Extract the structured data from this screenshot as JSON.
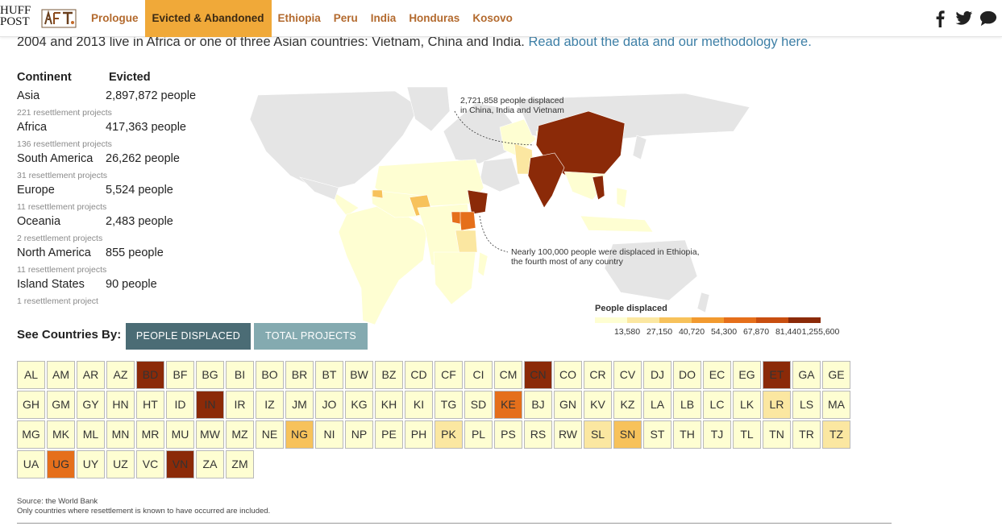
{
  "header": {
    "logo_line1": "HUFF",
    "logo_line2": "POST",
    "nav": [
      {
        "label": "Prologue",
        "active": false
      },
      {
        "label": "Evicted & Abandoned",
        "active": true
      },
      {
        "label": "Ethiopia",
        "active": false
      },
      {
        "label": "Peru",
        "active": false
      },
      {
        "label": "India",
        "active": false
      },
      {
        "label": "Honduras",
        "active": false
      },
      {
        "label": "Kosovo",
        "active": false
      }
    ],
    "social": [
      "facebook-icon",
      "twitter-icon",
      "comment-icon"
    ]
  },
  "intro": {
    "text": "2004 and 2013 live in Africa or one of three Asian countries: Vietnam, China and India. ",
    "link": "Read about the data and our methodology here."
  },
  "continents": {
    "col1": "Continent",
    "col2": "Evicted",
    "rows": [
      {
        "name": "Asia",
        "value": "2,897,872 people",
        "projects": "221 resettlement projects"
      },
      {
        "name": "Africa",
        "value": "417,363 people",
        "projects": "136 resettlement projects"
      },
      {
        "name": "South America",
        "value": "26,262 people",
        "projects": "31 resettlement projects"
      },
      {
        "name": "Europe",
        "value": "5,524 people",
        "projects": "11 resettlement projects"
      },
      {
        "name": "Oceania",
        "value": "2,483 people",
        "projects": "2 resettlement projects"
      },
      {
        "name": "North America",
        "value": "855 people",
        "projects": "11 resettlement projects"
      },
      {
        "name": "Island States",
        "value": "90 people",
        "projects": "1 resettlement project"
      }
    ]
  },
  "map": {
    "annotation_asia_line1": "2,721,858 people displaced",
    "annotation_asia_line2": "in China, India and Vietnam",
    "annotation_ethiopia_line1": "Nearly 100,000 people were displaced in Ethiopia,",
    "annotation_ethiopia_line2": "the fourth most of any country",
    "colors": {
      "none": "#e0e0e0",
      "c1": "#fefed2",
      "c2": "#fbe7a1",
      "c3": "#f7c25b",
      "c4": "#f29a2f",
      "c5": "#e56f1b",
      "c6": "#c84e10",
      "c7": "#8b2a08"
    }
  },
  "legend": {
    "title": "People displaced",
    "colors": [
      "#fefed2",
      "#fbe7a1",
      "#f7c25b",
      "#f29a2f",
      "#e56f1b",
      "#c84e10",
      "#8b2a08"
    ],
    "ticks": [
      "13,580",
      "27,150",
      "40,720",
      "54,300",
      "67,870",
      "81,440",
      "1,255,600"
    ]
  },
  "controls": {
    "see_label": "See Countries By:",
    "btn_people": "PEOPLE DISPLACED",
    "btn_projects": "TOTAL PROJECTS"
  },
  "countries": [
    {
      "code": "AL",
      "level": 1
    },
    {
      "code": "AM",
      "level": 1
    },
    {
      "code": "AR",
      "level": 1
    },
    {
      "code": "AZ",
      "level": 1
    },
    {
      "code": "BD",
      "level": 7
    },
    {
      "code": "BF",
      "level": 1
    },
    {
      "code": "BG",
      "level": 1
    },
    {
      "code": "BI",
      "level": 1
    },
    {
      "code": "BO",
      "level": 1
    },
    {
      "code": "BR",
      "level": 1
    },
    {
      "code": "BT",
      "level": 1
    },
    {
      "code": "BW",
      "level": 1
    },
    {
      "code": "BZ",
      "level": 1
    },
    {
      "code": "CD",
      "level": 1
    },
    {
      "code": "CF",
      "level": 1
    },
    {
      "code": "CI",
      "level": 1
    },
    {
      "code": "CM",
      "level": 1
    },
    {
      "code": "CN",
      "level": 7
    },
    {
      "code": "CO",
      "level": 1
    },
    {
      "code": "CR",
      "level": 1
    },
    {
      "code": "CV",
      "level": 1
    },
    {
      "code": "DJ",
      "level": 1
    },
    {
      "code": "DO",
      "level": 1
    },
    {
      "code": "EC",
      "level": 1
    },
    {
      "code": "EG",
      "level": 1
    },
    {
      "code": "ET",
      "level": 7
    },
    {
      "code": "GA",
      "level": 1
    },
    {
      "code": "GE",
      "level": 1
    },
    {
      "code": "GH",
      "level": 1
    },
    {
      "code": "GM",
      "level": 1
    },
    {
      "code": "GY",
      "level": 1
    },
    {
      "code": "HN",
      "level": 1
    },
    {
      "code": "HT",
      "level": 1
    },
    {
      "code": "ID",
      "level": 1
    },
    {
      "code": "IN",
      "level": 7
    },
    {
      "code": "IR",
      "level": 1
    },
    {
      "code": "IZ",
      "level": 1
    },
    {
      "code": "JM",
      "level": 1
    },
    {
      "code": "JO",
      "level": 1
    },
    {
      "code": "KG",
      "level": 1
    },
    {
      "code": "KH",
      "level": 1
    },
    {
      "code": "KI",
      "level": 1
    },
    {
      "code": "TG",
      "level": 1
    },
    {
      "code": "SD",
      "level": 1
    },
    {
      "code": "KE",
      "level": 5
    },
    {
      "code": "BJ",
      "level": 1
    },
    {
      "code": "GN",
      "level": 1
    },
    {
      "code": "KV",
      "level": 1
    },
    {
      "code": "KZ",
      "level": 1
    },
    {
      "code": "LA",
      "level": 1
    },
    {
      "code": "LB",
      "level": 1
    },
    {
      "code": "LC",
      "level": 1
    },
    {
      "code": "LK",
      "level": 1
    },
    {
      "code": "LR",
      "level": 2
    },
    {
      "code": "LS",
      "level": 1
    },
    {
      "code": "MA",
      "level": 1
    },
    {
      "code": "MG",
      "level": 1
    },
    {
      "code": "MK",
      "level": 1
    },
    {
      "code": "ML",
      "level": 1
    },
    {
      "code": "MN",
      "level": 1
    },
    {
      "code": "MR",
      "level": 1
    },
    {
      "code": "MU",
      "level": 1
    },
    {
      "code": "MW",
      "level": 1
    },
    {
      "code": "MZ",
      "level": 1
    },
    {
      "code": "NE",
      "level": 1
    },
    {
      "code": "NG",
      "level": 3
    },
    {
      "code": "NI",
      "level": 1
    },
    {
      "code": "NP",
      "level": 1
    },
    {
      "code": "PE",
      "level": 1
    },
    {
      "code": "PH",
      "level": 1
    },
    {
      "code": "PK",
      "level": 2
    },
    {
      "code": "PL",
      "level": 1
    },
    {
      "code": "PS",
      "level": 1
    },
    {
      "code": "RS",
      "level": 1
    },
    {
      "code": "RW",
      "level": 1
    },
    {
      "code": "SL",
      "level": 2
    },
    {
      "code": "SN",
      "level": 3
    },
    {
      "code": "ST",
      "level": 1
    },
    {
      "code": "TH",
      "level": 1
    },
    {
      "code": "TJ",
      "level": 1
    },
    {
      "code": "TL",
      "level": 1
    },
    {
      "code": "TN",
      "level": 1
    },
    {
      "code": "TR",
      "level": 1
    },
    {
      "code": "TZ",
      "level": 2
    },
    {
      "code": "UA",
      "level": 1
    },
    {
      "code": "UG",
      "level": 5
    },
    {
      "code": "UY",
      "level": 1
    },
    {
      "code": "UZ",
      "level": 1
    },
    {
      "code": "VC",
      "level": 1
    },
    {
      "code": "VN",
      "level": 7
    },
    {
      "code": "ZA",
      "level": 1
    },
    {
      "code": "ZM",
      "level": 1
    }
  ],
  "footer": {
    "source": "Source: the World Bank",
    "note": "Only countries where resettlement is known to have occurred are included."
  }
}
